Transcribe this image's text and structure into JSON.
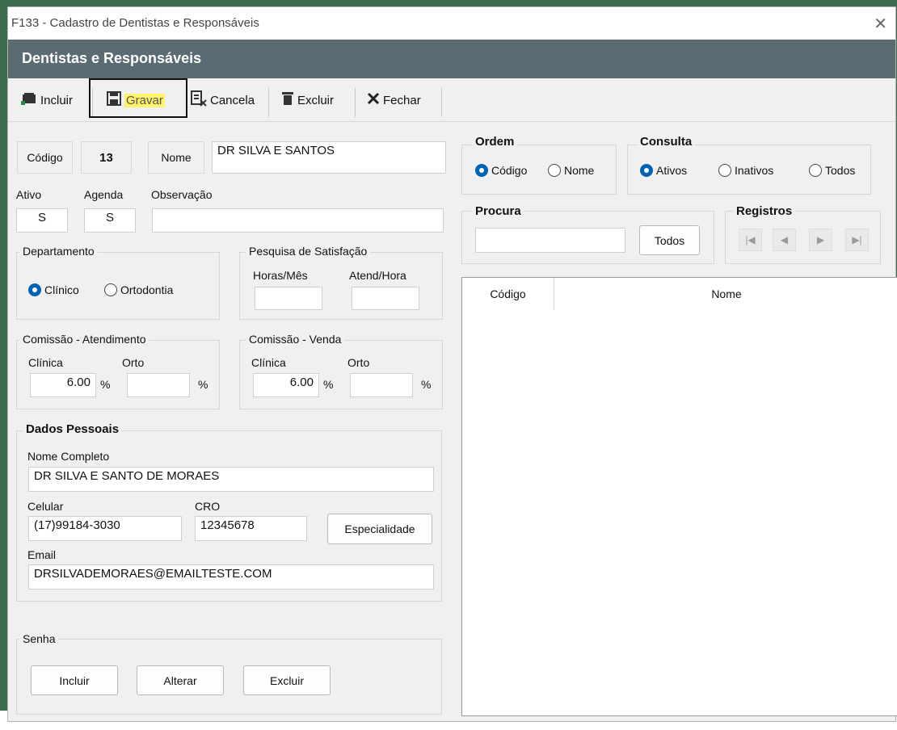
{
  "window": {
    "title": "F133 - Cadastro de Dentistas e Responsáveis",
    "close_glyph": "✕"
  },
  "header": {
    "title": "Dentistas e Responsáveis"
  },
  "toolbar": {
    "incluir": "Incluir",
    "gravar": "Gravar",
    "cancela": "Cancela",
    "excluir": "Excluir",
    "fechar": "Fechar"
  },
  "form": {
    "codigo_label": "Código",
    "codigo_value": "13",
    "nome_label": "Nome",
    "nome_value": "DR SILVA E SANTOS",
    "ativo_label": "Ativo",
    "ativo_value": "S",
    "agenda_label": "Agenda",
    "agenda_value": "S",
    "observacao_label": "Observação",
    "observacao_value": ""
  },
  "departamento": {
    "title": "Departamento",
    "options": [
      "Clínico",
      "Ortodontia"
    ],
    "selected": "Clínico"
  },
  "pesquisa": {
    "title": "Pesquisa de Satisfação",
    "horas_label": "Horas/Mês",
    "atend_label": "Atend/Hora",
    "horas_value": "",
    "atend_value": ""
  },
  "comissao_atendimento": {
    "title": "Comissão - Atendimento",
    "clinica_label": "Clínica",
    "orto_label": "Orto",
    "clinica_value": "6.00",
    "orto_value": "",
    "pct": "%"
  },
  "comissao_venda": {
    "title": "Comissão - Venda",
    "clinica_label": "Clínica",
    "orto_label": "Orto",
    "clinica_value": "6.00",
    "orto_value": "",
    "pct": "%"
  },
  "dados_pessoais": {
    "title": "Dados Pessoais",
    "nome_completo_label": "Nome Completo",
    "nome_completo_value": "DR SILVA E SANTO DE MORAES",
    "celular_label": "Celular",
    "celular_value": "(17)99184-3030",
    "cro_label": "CRO",
    "cro_value": "12345678",
    "especialidade_button": "Especialidade",
    "email_label": "Email",
    "email_value": "DRSILVADEMORAES@EMAILTESTE.COM"
  },
  "senha": {
    "title": "Senha",
    "incluir": "Incluir",
    "alterar": "Alterar",
    "excluir": "Excluir"
  },
  "ordem": {
    "title": "Ordem",
    "options": [
      "Código",
      "Nome"
    ],
    "selected": "Código"
  },
  "consulta": {
    "title": "Consulta",
    "options": [
      "Ativos",
      "Inativos",
      "Todos"
    ],
    "selected": "Ativos"
  },
  "procura": {
    "title": "Procura",
    "value": "",
    "todos_button": "Todos"
  },
  "registros": {
    "title": "Registros",
    "first": "|◀",
    "prev": "◀",
    "next": "▶",
    "last": "▶|"
  },
  "grid": {
    "columns": [
      "Código",
      "Nome"
    ],
    "rows": []
  },
  "colors": {
    "header_bg": "#5a6b72",
    "radio_accent": "#0063b1",
    "highlight": "#fff36b"
  }
}
